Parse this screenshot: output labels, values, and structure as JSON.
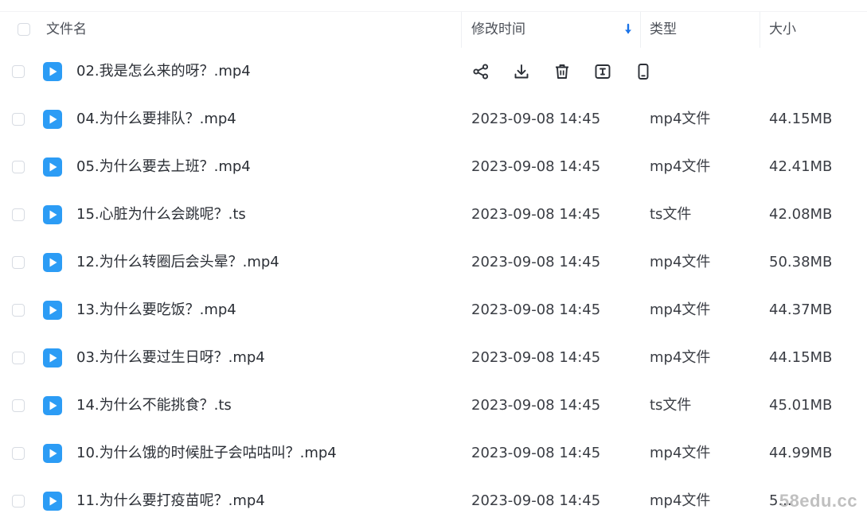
{
  "header": {
    "name_label": "文件名",
    "time_label": "修改时间",
    "type_label": "类型",
    "size_label": "大小",
    "sort_icon": "sort-down-arrow-icon",
    "accent_color": "#1a73e8"
  },
  "hover_actions": [
    {
      "name": "share-icon"
    },
    {
      "name": "download-icon"
    },
    {
      "name": "delete-icon"
    },
    {
      "name": "rename-icon"
    },
    {
      "name": "mobile-icon"
    }
  ],
  "files": [
    {
      "name": "02.我是怎么来的呀？.mp4",
      "time": "",
      "type": "",
      "size": "",
      "hovered": true
    },
    {
      "name": "04.为什么要排队？.mp4",
      "time": "2023-09-08 14:45",
      "type": "mp4文件",
      "size": "44.15MB"
    },
    {
      "name": "05.为什么要去上班？.mp4",
      "time": "2023-09-08 14:45",
      "type": "mp4文件",
      "size": "42.41MB"
    },
    {
      "name": "15.心脏为什么会跳呢？.ts",
      "time": "2023-09-08 14:45",
      "type": "ts文件",
      "size": "42.08MB"
    },
    {
      "name": "12.为什么转圈后会头晕？.mp4",
      "time": "2023-09-08 14:45",
      "type": "mp4文件",
      "size": "50.38MB"
    },
    {
      "name": "13.为什么要吃饭？.mp4",
      "time": "2023-09-08 14:45",
      "type": "mp4文件",
      "size": "44.37MB"
    },
    {
      "name": "03.为什么要过生日呀？.mp4",
      "time": "2023-09-08 14:45",
      "type": "mp4文件",
      "size": "44.15MB"
    },
    {
      "name": "14.为什么不能挑食？.ts",
      "time": "2023-09-08 14:45",
      "type": "ts文件",
      "size": "45.01MB"
    },
    {
      "name": "10.为什么饿的时候肚子会咕咕叫？.mp4",
      "time": "2023-09-08 14:45",
      "type": "mp4文件",
      "size": "44.99MB"
    },
    {
      "name": "11.为什么要打疫苗呢？.mp4",
      "time": "2023-09-08 14:45",
      "type": "mp4文件",
      "size": "5..."
    }
  ],
  "file_icon_color": "#2c9cf5",
  "watermark": "58edu.cc"
}
